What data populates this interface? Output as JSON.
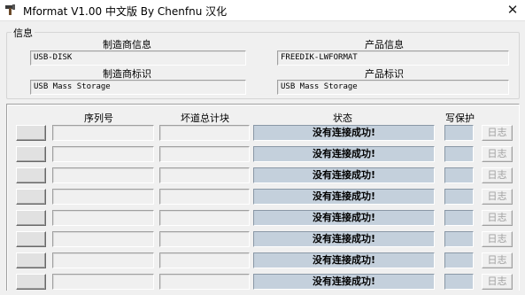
{
  "window": {
    "title": "Mformat V1.00 中文版 By Chenfnu 汉化",
    "close_glyph": "✕"
  },
  "info": {
    "legend": "信息",
    "vendor_info_label": "制造商信息",
    "vendor_info_value": "USB-DISK",
    "product_info_label": "产品信息",
    "product_info_value": "FREEDIK-LWFORMAT",
    "vendor_id_label": "制造商标识",
    "vendor_id_value": "USB Mass Storage",
    "product_id_label": "产品标识",
    "product_id_value": "USB Mass Storage"
  },
  "table": {
    "headers": {
      "serial": "序列号",
      "bad_blocks": "坏道总计块",
      "status": "状态",
      "write_protect": "写保护"
    },
    "rows": [
      {
        "serial": "",
        "bad_blocks": "",
        "status": "没有连接成功!",
        "log": "日志"
      },
      {
        "serial": "",
        "bad_blocks": "",
        "status": "没有连接成功!",
        "log": "日志"
      },
      {
        "serial": "",
        "bad_blocks": "",
        "status": "没有连接成功!",
        "log": "日志"
      },
      {
        "serial": "",
        "bad_blocks": "",
        "status": "没有连接成功!",
        "log": "日志"
      },
      {
        "serial": "",
        "bad_blocks": "",
        "status": "没有连接成功!",
        "log": "日志"
      },
      {
        "serial": "",
        "bad_blocks": "",
        "status": "没有连接成功!",
        "log": "日志"
      },
      {
        "serial": "",
        "bad_blocks": "",
        "status": "没有连接成功!",
        "log": "日志"
      },
      {
        "serial": "",
        "bad_blocks": "",
        "status": "没有连接成功!",
        "log": "日志"
      }
    ]
  },
  "colors": {
    "status_bg": "#c4d0dc",
    "window_bg": "#f0f0f0",
    "disabled_text": "#a0a0a0"
  },
  "icons": {
    "app": "hammer-icon",
    "close": "close-icon"
  }
}
